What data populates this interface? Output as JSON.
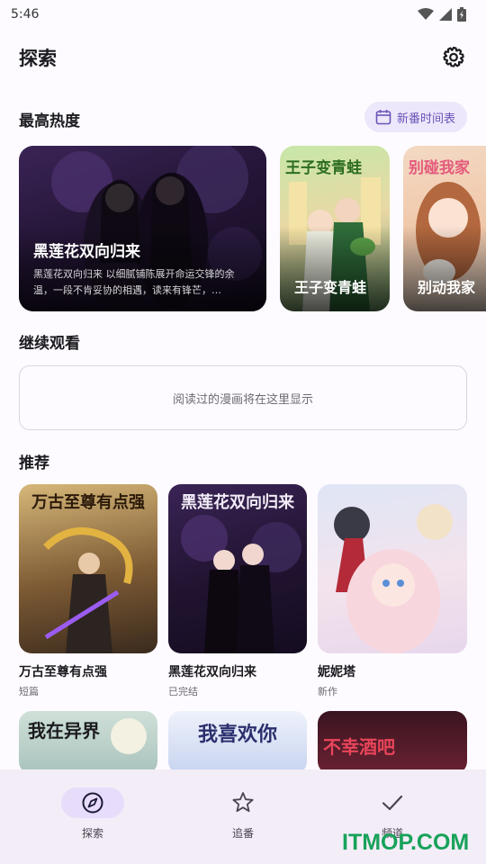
{
  "status": {
    "time": "5:46"
  },
  "header": {
    "title": "探索"
  },
  "hot": {
    "heading": "最高热度",
    "schedule_label": "新番时间表",
    "cards": [
      {
        "title": "黑莲花双向归来",
        "desc": "黑莲花双向归来 以细腻铺陈展开命运交锋的余温，一段不肯妥协的相遇，读来有锋芒，…"
      },
      {
        "title": "王子变青蛙",
        "art_title": "王子变青蛙"
      },
      {
        "title": "别动我家",
        "art_title": "别碰我家"
      }
    ]
  },
  "continue": {
    "heading": "继续观看",
    "empty_text": "阅读过的漫画将在这里显示"
  },
  "recommend": {
    "heading": "推荐",
    "items": [
      {
        "title": "万古至尊有点强",
        "sub": "短篇",
        "art_title": "万古至尊有点强"
      },
      {
        "title": "黑莲花双向归来",
        "sub": "已完结",
        "art_title": "黑莲花双向归来"
      },
      {
        "title": "妮妮塔",
        "sub": "新作",
        "art_title": ""
      }
    ],
    "row2": [
      {
        "art_title": "我在异界"
      },
      {
        "art_title": "我喜欢你"
      },
      {
        "art_title": "不幸酒吧"
      }
    ]
  },
  "nav": {
    "items": [
      {
        "label": "探索",
        "icon": "compass-icon",
        "active": true
      },
      {
        "label": "追番",
        "icon": "star-icon",
        "active": false
      },
      {
        "label": "频道",
        "icon": "check-icon",
        "active": false
      }
    ]
  },
  "watermark": "ITMOP.COM",
  "colors": {
    "accent": "#6b53b8",
    "accent_container": "#e7ddfb",
    "nav_bg": "#f3edf7",
    "watermark": "#17a25a"
  }
}
